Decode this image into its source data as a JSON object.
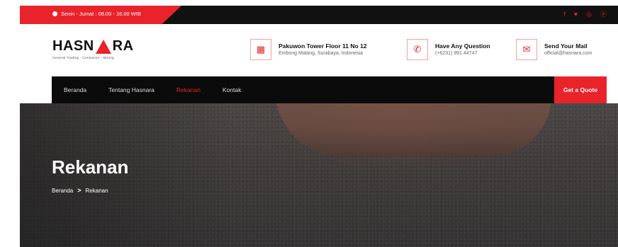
{
  "topbar": {
    "hours": "Senin - Jumat : 08.00 - 16.00 WIB",
    "socials": [
      "facebook-icon",
      "twitter-icon",
      "instagram-icon",
      "pinterest-icon"
    ]
  },
  "brand": {
    "name_left": "HASN",
    "name_right": "RA",
    "tagline": "General Trading - Contractor - Mining"
  },
  "contacts": [
    {
      "icon": "building-icon",
      "title": "Pakuwon Tower Floor 11 No 12",
      "sub": "Embong Malang, Surabaya, Indonesia"
    },
    {
      "icon": "phone-icon",
      "title": "Have Any Question",
      "sub": "(+6231) 991 44747"
    },
    {
      "icon": "mail-icon",
      "title": "Send Your Mail",
      "sub": "official@hasnara.com"
    }
  ],
  "nav": {
    "items": [
      "Beranda",
      "Tentang Hasnara",
      "Rekanan",
      "Kontak"
    ],
    "active": "Rekanan",
    "cta": "Get a Quote"
  },
  "hero": {
    "title": "Rekanan",
    "breadcrumb": [
      "Beranda",
      "Rekanan"
    ],
    "separator": ">"
  },
  "colors": {
    "accent": "#e8232a",
    "dark": "#0b0b0b"
  }
}
